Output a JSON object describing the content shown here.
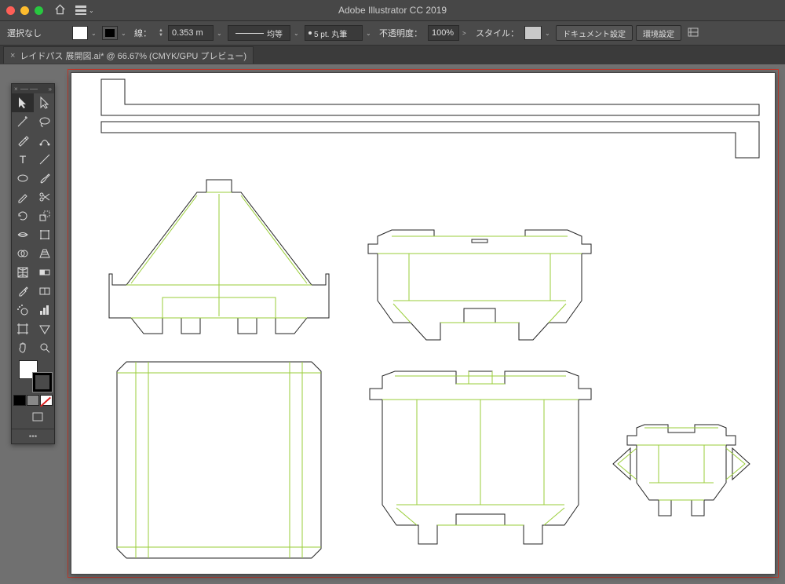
{
  "app": {
    "title": "Adobe Illustrator CC 2019"
  },
  "controlbar": {
    "selection_state": "選択なし",
    "stroke_label": "線：",
    "stroke_value": "0.353 m",
    "stroke_uniform": "均等",
    "brush_label": "5 pt. 丸筆",
    "opacity_label": "不透明度：",
    "opacity_value": "100%",
    "style_label": "スタイル：",
    "doc_settings": "ドキュメント設定",
    "env_settings": "環境設定"
  },
  "tab": {
    "close": "×",
    "label": "レイドパス 展開図.ai* @ 66.67% (CMYK/GPU プレビュー)"
  },
  "tools": [
    {
      "name": "selection",
      "icon": "cursor",
      "row": 0,
      "col": 0,
      "selected": true
    },
    {
      "name": "direct-selection",
      "icon": "cursor-open",
      "row": 0,
      "col": 1
    },
    {
      "name": "magic-wand",
      "icon": "wand",
      "row": 1,
      "col": 0
    },
    {
      "name": "lasso",
      "icon": "lasso",
      "row": 1,
      "col": 1
    },
    {
      "name": "pen",
      "icon": "pen",
      "row": 2,
      "col": 0
    },
    {
      "name": "curvature",
      "icon": "curve-pen",
      "row": 2,
      "col": 1
    },
    {
      "name": "type",
      "icon": "T",
      "row": 3,
      "col": 0
    },
    {
      "name": "line",
      "icon": "line",
      "row": 3,
      "col": 1
    },
    {
      "name": "ellipse",
      "icon": "ellipse",
      "row": 4,
      "col": 0
    },
    {
      "name": "brush",
      "icon": "brush",
      "row": 4,
      "col": 1
    },
    {
      "name": "shaper",
      "icon": "pencil",
      "row": 5,
      "col": 0
    },
    {
      "name": "scissors",
      "icon": "scissors",
      "row": 5,
      "col": 1
    },
    {
      "name": "rotate",
      "icon": "rotate",
      "row": 6,
      "col": 0
    },
    {
      "name": "scale",
      "icon": "scale",
      "row": 6,
      "col": 1
    },
    {
      "name": "width",
      "icon": "width",
      "row": 7,
      "col": 0
    },
    {
      "name": "free-transform",
      "icon": "freetrans",
      "row": 7,
      "col": 1
    },
    {
      "name": "shape-builder",
      "icon": "shapebuild",
      "row": 8,
      "col": 0
    },
    {
      "name": "perspective",
      "icon": "perspective",
      "row": 8,
      "col": 1
    },
    {
      "name": "mesh",
      "icon": "mesh",
      "row": 9,
      "col": 0
    },
    {
      "name": "gradient",
      "icon": "gradient",
      "row": 9,
      "col": 1
    },
    {
      "name": "eyedropper",
      "icon": "eyedrop",
      "row": 10,
      "col": 0
    },
    {
      "name": "blend",
      "icon": "blend",
      "row": 10,
      "col": 1
    },
    {
      "name": "symbol-spray",
      "icon": "spray",
      "row": 11,
      "col": 0
    },
    {
      "name": "graph",
      "icon": "graph",
      "row": 11,
      "col": 1
    },
    {
      "name": "artboard",
      "icon": "artboard",
      "row": 12,
      "col": 0
    },
    {
      "name": "slice",
      "icon": "slice",
      "row": 12,
      "col": 1
    },
    {
      "name": "hand",
      "icon": "hand",
      "row": 13,
      "col": 0
    },
    {
      "name": "zoom",
      "icon": "zoom",
      "row": 13,
      "col": 1
    }
  ],
  "colors": {
    "fill": "#ffffff",
    "stroke": "#000000"
  }
}
